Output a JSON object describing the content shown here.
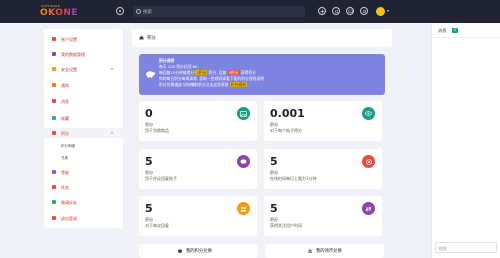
{
  "logo": {
    "text": "OKONE",
    "sub": "SOFTWARE"
  },
  "search": {
    "placeholder": "搜索"
  },
  "breadcrumb": {
    "label": "积分"
  },
  "sidebar": {
    "items": [
      {
        "label": "账户设置",
        "color": "#e74c3c"
      },
      {
        "label": "我的数据管理",
        "color": "#8e44ad"
      },
      {
        "label": "安全设置",
        "color": "#f39c12"
      },
      {
        "label": "通知",
        "color": "#e67e22"
      },
      {
        "label": "消息",
        "color": "#e74c3c"
      },
      {
        "label": "收藏",
        "color": "#3498db"
      },
      {
        "label": "积分",
        "color": "#e74c3c"
      },
      {
        "label": "积分明细",
        "color": "#999"
      },
      {
        "label": "兑换",
        "color": "#999"
      },
      {
        "label": "等级",
        "color": "#9b59b6"
      },
      {
        "label": "任务",
        "color": "#e74c3c"
      },
      {
        "label": "邀请好友",
        "color": "#27ae60"
      },
      {
        "label": "退出登录",
        "color": "#e74c3c"
      }
    ]
  },
  "banner": {
    "title": "积分说明",
    "line1": "每天 100 积分封顶 60",
    "line2_a": "每回复10分钟能得分",
    "line2_tag1": "2积分",
    "line2_b": "积分, 回复",
    "line2_tag2": "5积分",
    "line2_c": "获得积分",
    "line3": "你的每日积分每周清零, 获取一些规则请看下面的积分规则说明",
    "line4_a": "积分兑换通道 如何赚取积分点击这里获取",
    "line4_link": "积分规则",
    "color": "#7e83e0"
  },
  "cards": [
    {
      "num": "0",
      "unit": "积分",
      "desc": "用于兑换商品",
      "icon": "image-icon",
      "color": "#16a085"
    },
    {
      "num": "0.001",
      "unit": "积分",
      "desc": "对于每个帖子得分",
      "icon": "eye-icon",
      "color": "#16a085"
    },
    {
      "num": "5",
      "unit": "积分",
      "desc": "用于评论回复帖子",
      "icon": "chat-icon",
      "color": "#8e44ad"
    },
    {
      "num": "5",
      "unit": "积分",
      "desc": "在线时间每日上限为1分钟",
      "icon": "record-icon",
      "color": "#e74c3c"
    },
    {
      "num": "5",
      "unit": "积分",
      "desc": "对于每次回复",
      "icon": "group-icon",
      "color": "#f39c12"
    },
    {
      "num": "5",
      "unit": "积分",
      "desc": "获得关注用户时间",
      "icon": "swap-icon",
      "color": "#8e44ad"
    }
  ],
  "buttons": {
    "left": "我的积分兑换",
    "right": "我的领币兑换"
  },
  "rightpanel": {
    "title": "消息",
    "badge": "0",
    "input_placeholder": "搜索"
  }
}
